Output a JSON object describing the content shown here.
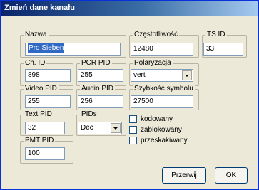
{
  "window": {
    "title": "Zmień dane kanału"
  },
  "fields": {
    "name": {
      "label": "Nazwa",
      "value": "Pro Sieben"
    },
    "frequency": {
      "label": "Częstotliwość",
      "value": "12480"
    },
    "ts_id": {
      "label": "TS ID",
      "value": "33"
    },
    "ch_id": {
      "label": "Ch. ID",
      "value": "898"
    },
    "pcr_pid": {
      "label": "PCR PID",
      "value": "255"
    },
    "polarization": {
      "label": "Polaryzacja",
      "value": "vert"
    },
    "video_pid": {
      "label": "Video PID",
      "value": "255"
    },
    "audio_pid": {
      "label": "Audio PID",
      "value": "256"
    },
    "symbol_rate": {
      "label": "Szybkość symbolu",
      "value": "27500"
    },
    "text_pid": {
      "label": "Text PID",
      "value": "32"
    },
    "pids": {
      "label": "PIDs",
      "value": "Dec"
    },
    "pmt_pid": {
      "label": "PMT PID",
      "value": "100"
    }
  },
  "checkboxes": [
    {
      "label": "kodowany",
      "checked": false
    },
    {
      "label": "zablokowany",
      "checked": false
    },
    {
      "label": "przeskakiwany",
      "checked": false
    }
  ],
  "buttons": {
    "cancel": "Przerwij",
    "ok": "OK"
  }
}
